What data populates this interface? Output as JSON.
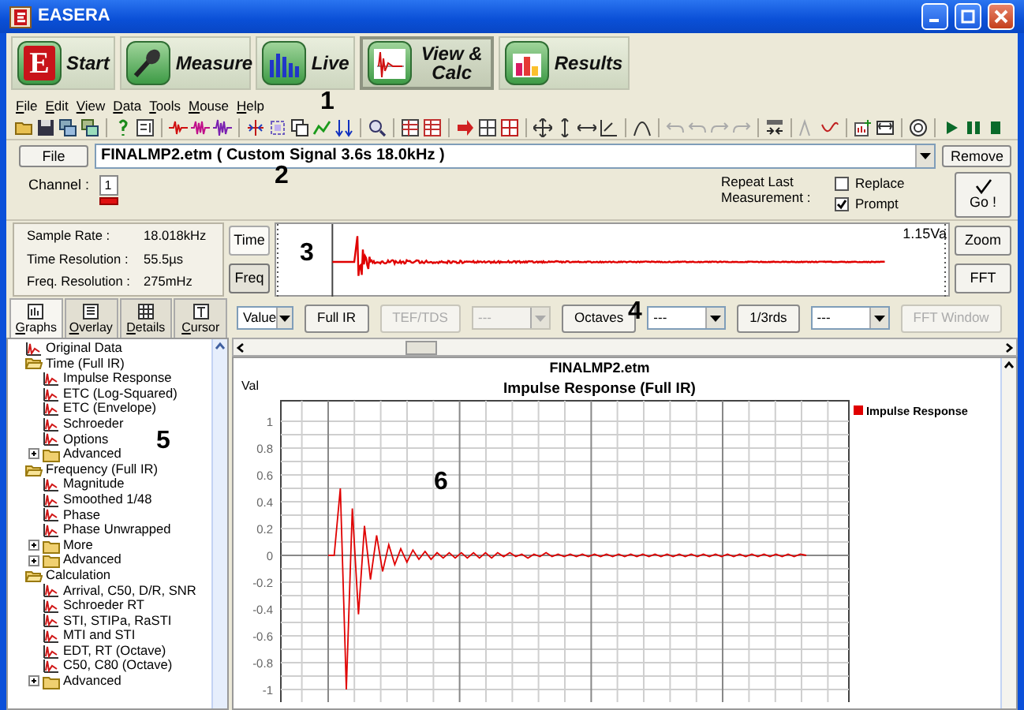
{
  "window": {
    "title": "EASERA"
  },
  "main_tabs": [
    {
      "label": "Start",
      "badge": "E",
      "selected": false
    },
    {
      "label": "Measure",
      "selected": false
    },
    {
      "label": "Live",
      "selected": false
    },
    {
      "label": "View & Calc",
      "selected": true
    },
    {
      "label": "Results",
      "selected": false
    }
  ],
  "menu": [
    "File",
    "Edit",
    "View",
    "Data",
    "Tools",
    "Mouse",
    "Help"
  ],
  "file_bar": {
    "button": "File",
    "file": "FINALMP2.etm ( Custom Signal 3.6s 18.0kHz )",
    "remove": "Remove"
  },
  "channel": {
    "label": "Channel :",
    "value": "1"
  },
  "repeat": {
    "label": "Repeat Last Measurement :",
    "options": [
      {
        "label": "Replace",
        "checked": false
      },
      {
        "label": "Prompt",
        "checked": true
      }
    ],
    "go": "Go !"
  },
  "info": [
    {
      "label": "Sample Rate :",
      "value": "18.018kHz"
    },
    {
      "label": "Time Resolution :",
      "value": "55.5µs"
    },
    {
      "label": "Freq. Resolution :",
      "value": "275mHz"
    }
  ],
  "overview": {
    "modes": [
      {
        "label": "Time",
        "selected": true
      },
      {
        "label": "Freq",
        "selected": false
      }
    ],
    "reading": "1.15Va",
    "buttons": [
      "Zoom",
      "FFT"
    ]
  },
  "view_tabs": [
    {
      "label": "Graphs",
      "selected": true
    },
    {
      "label": "Overlay",
      "selected": false
    },
    {
      "label": "Details",
      "selected": false
    },
    {
      "label": "Cursor",
      "selected": false
    }
  ],
  "graph_toolbar": [
    {
      "kind": "select",
      "value": "Value",
      "disabled": false
    },
    {
      "kind": "button",
      "label": "Full IR",
      "disabled": false
    },
    {
      "kind": "button",
      "label": "TEF/TDS",
      "disabled": true
    },
    {
      "kind": "select",
      "value": "---",
      "disabled": true
    },
    {
      "kind": "button",
      "label": "Octaves",
      "disabled": false
    },
    {
      "kind": "select",
      "value": "---",
      "disabled": false
    },
    {
      "kind": "button",
      "label": "1/3rds",
      "disabled": false
    },
    {
      "kind": "select",
      "value": "---",
      "disabled": false
    },
    {
      "kind": "button",
      "label": "FFT Window",
      "disabled": true
    }
  ],
  "tree": [
    {
      "label": "Original Data",
      "kind": "leaf"
    },
    {
      "label": "Time (Full IR)",
      "kind": "folder",
      "expanded": true,
      "children": [
        {
          "label": "Impulse Response",
          "kind": "leaf"
        },
        {
          "label": "ETC (Log-Squared)",
          "kind": "leaf"
        },
        {
          "label": "ETC (Envelope)",
          "kind": "leaf"
        },
        {
          "label": "Schroeder",
          "kind": "leaf"
        },
        {
          "label": "Options",
          "kind": "leaf"
        },
        {
          "label": "Advanced",
          "kind": "folder",
          "expanded": false
        }
      ]
    },
    {
      "label": "Frequency (Full IR)",
      "kind": "folder",
      "expanded": true,
      "children": [
        {
          "label": "Magnitude",
          "kind": "leaf"
        },
        {
          "label": "Smoothed 1/48",
          "kind": "leaf"
        },
        {
          "label": "Phase",
          "kind": "leaf"
        },
        {
          "label": "Phase Unwrapped",
          "kind": "leaf"
        },
        {
          "label": "More",
          "kind": "folder",
          "expanded": false
        },
        {
          "label": "Advanced",
          "kind": "folder",
          "expanded": false
        }
      ]
    },
    {
      "label": "Calculation",
      "kind": "folder",
      "expanded": true,
      "children": [
        {
          "label": "Arrival, C50, D/R, SNR",
          "kind": "leaf"
        },
        {
          "label": "Schroeder RT",
          "kind": "leaf"
        },
        {
          "label": "STI, STIPa, RaSTI",
          "kind": "leaf"
        },
        {
          "label": "MTI and STI",
          "kind": "leaf"
        },
        {
          "label": "EDT, RT (Octave)",
          "kind": "leaf"
        },
        {
          "label": "C50, C80 (Octave)",
          "kind": "leaf"
        },
        {
          "label": "Advanced",
          "kind": "folder",
          "expanded": false
        }
      ]
    }
  ],
  "graph": {
    "file_label": "FINALMP2.etm",
    "chart_data": {
      "type": "line",
      "title": "Impulse Response (Full IR)",
      "ylabel": "Val",
      "ylim": [
        -1,
        1
      ],
      "yticks": [
        1,
        0.8,
        0.6,
        0.4,
        0.2,
        0,
        -0.2,
        -0.4,
        -0.6,
        -0.8,
        -1
      ],
      "grid": true,
      "series": [
        {
          "name": "Impulse Response",
          "color": "#e00000",
          "values": [
            0,
            0,
            0.5,
            -1,
            0.35,
            -0.44,
            0.22,
            -0.18,
            0.15,
            -0.12,
            0.08,
            -0.07,
            0.05,
            -0.05,
            0.04,
            -0.03,
            0.03,
            -0.03,
            0.02,
            -0.02,
            0.02,
            -0.02,
            0.02,
            -0.02,
            0.02,
            -0.02,
            0.02,
            -0.02,
            0.02,
            -0.01,
            0.02,
            -0.01,
            0.01,
            -0.02,
            0.01,
            -0.01,
            0.02,
            -0.01,
            0.01,
            -0.01,
            0.01,
            -0.01,
            0.01,
            -0.01,
            0.01,
            -0.01,
            0.01,
            -0.01,
            0.01,
            -0.01,
            0.01,
            -0.01,
            0.01,
            -0.01,
            0.01,
            -0.01,
            0.01,
            -0.01,
            0.01,
            -0.01,
            0.01,
            -0.01,
            0.01,
            -0.01,
            0.01,
            -0.01,
            0.01,
            -0.01,
            0.01,
            -0.01,
            0.01,
            -0.01,
            0.01,
            -0.01,
            0.01,
            -0.01,
            0.01,
            -0.01,
            0.01,
            0
          ]
        }
      ]
    }
  },
  "callouts": [
    "1",
    "2",
    "3",
    "4",
    "5",
    "6"
  ]
}
